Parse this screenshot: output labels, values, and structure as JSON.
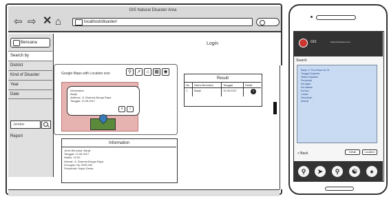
{
  "browser": {
    "title": "GIS Natural Disaster Area",
    "url": "localhost/disaster/",
    "nav_icons": [
      "back-arrow-icon",
      "forward-arrow-icon",
      "close-icon",
      "home-icon"
    ],
    "scroll_position_percent": 35
  },
  "sidebar": {
    "logo": "Bencana",
    "items": [
      {
        "label": "Search by",
        "selected": true
      },
      {
        "label": "District",
        "selected": false
      },
      {
        "label": "Kind of Disaster",
        "selected": false
      },
      {
        "label": "Year",
        "selected": false
      },
      {
        "label": "Date",
        "selected": false
      }
    ],
    "search_value": "Jember",
    "report_label": "Report"
  },
  "header": {
    "login_label": "Login"
  },
  "map": {
    "label": "Google Maps with Location icon",
    "tools": [
      "location-pin-icon",
      "arrow-icon",
      "home-icon",
      "grid-icon",
      "eye-icon"
    ],
    "popup": [
      "Information",
      "Banjir",
      "Address: Jl. Dharma Bunga Raya",
      "Tanggal: 12.05.2017"
    ],
    "popup_buttons": [
      "x",
      "i"
    ],
    "colors": {
      "map": "#e7b3b0",
      "marker": "#3a7ab8",
      "region": "#5a8a3a"
    }
  },
  "result": {
    "title": "Result",
    "columns": [
      "No",
      "Nama Bencana",
      "Tanggal",
      "Detail"
    ],
    "rows": [
      {
        "no": "1",
        "name": "Banjir",
        "date": "12.05.2017"
      }
    ]
  },
  "information": {
    "title": "Information",
    "lines": [
      "Jenis Bencana: Banjir",
      "Tanggal: 12.05.2017",
      "Waktu: 10.00",
      "Alamat: Jl. Dharma Bunga Raya",
      "Kerugian: Rp 2000.000",
      "Penyebab: Hujan Deras"
    ]
  },
  "phone": {
    "app_title": "GIS",
    "app_subtitle": "Natural Disaster Area",
    "search_label": "Search",
    "list": [
      "Banjir Jl. Pos Rawa No 21",
      "Tanggal Kejadian",
      "Waktu Kejadian",
      "Penyebab",
      "Kerugian",
      "Kerusakan",
      "Korban",
      "Lokasi",
      "Kelurahan",
      "Alamat"
    ],
    "back_label": "< Back",
    "buttons": [
      "Detail",
      "Location"
    ],
    "tabs": [
      "location-icon",
      "navigation-icon",
      "search-icon",
      "share-icon",
      "user-icon"
    ]
  }
}
